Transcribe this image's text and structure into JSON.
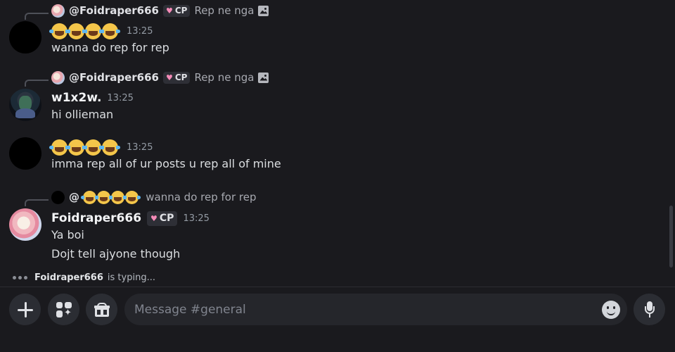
{
  "messages": [
    {
      "reply": {
        "name": "@Foidraper666",
        "badge": "CP",
        "text": "Rep ne nga"
      },
      "time": "13:25",
      "emoji_count": 4,
      "text": "wanna do rep for rep"
    },
    {
      "reply": {
        "name": "@Foidraper666",
        "badge": "CP",
        "text": "Rep ne nga"
      },
      "username": "w1x2w.",
      "time": "13:25",
      "text": "hi ollieman"
    },
    {
      "time": "13:25",
      "emoji_count": 4,
      "text": "imma rep all of ur posts u rep all of mine"
    },
    {
      "reply": {
        "name": "@",
        "text": "wanna do rep for rep",
        "emoji_count": 4
      },
      "username": "Foidraper666",
      "badge": "CP",
      "time": "13:25",
      "lines": [
        "Ya boi",
        "Dojt tell ajyone though"
      ]
    }
  ],
  "typing": {
    "user": "Foidraper666",
    "text": "is typing..."
  },
  "composer": {
    "placeholder": "Message #general",
    "value": ""
  },
  "icons": {
    "add": "plus-icon",
    "apps": "apps-icon",
    "gift": "gift-icon",
    "emoji": "emoji-icon",
    "voice": "microphone-icon",
    "attachment": "image-icon",
    "badge": "heart-icon"
  },
  "colors": {
    "background": "#1a1a1e",
    "input": "#25262b",
    "badge_heart": "#f58bb8",
    "muted_text": "#949ba4"
  }
}
